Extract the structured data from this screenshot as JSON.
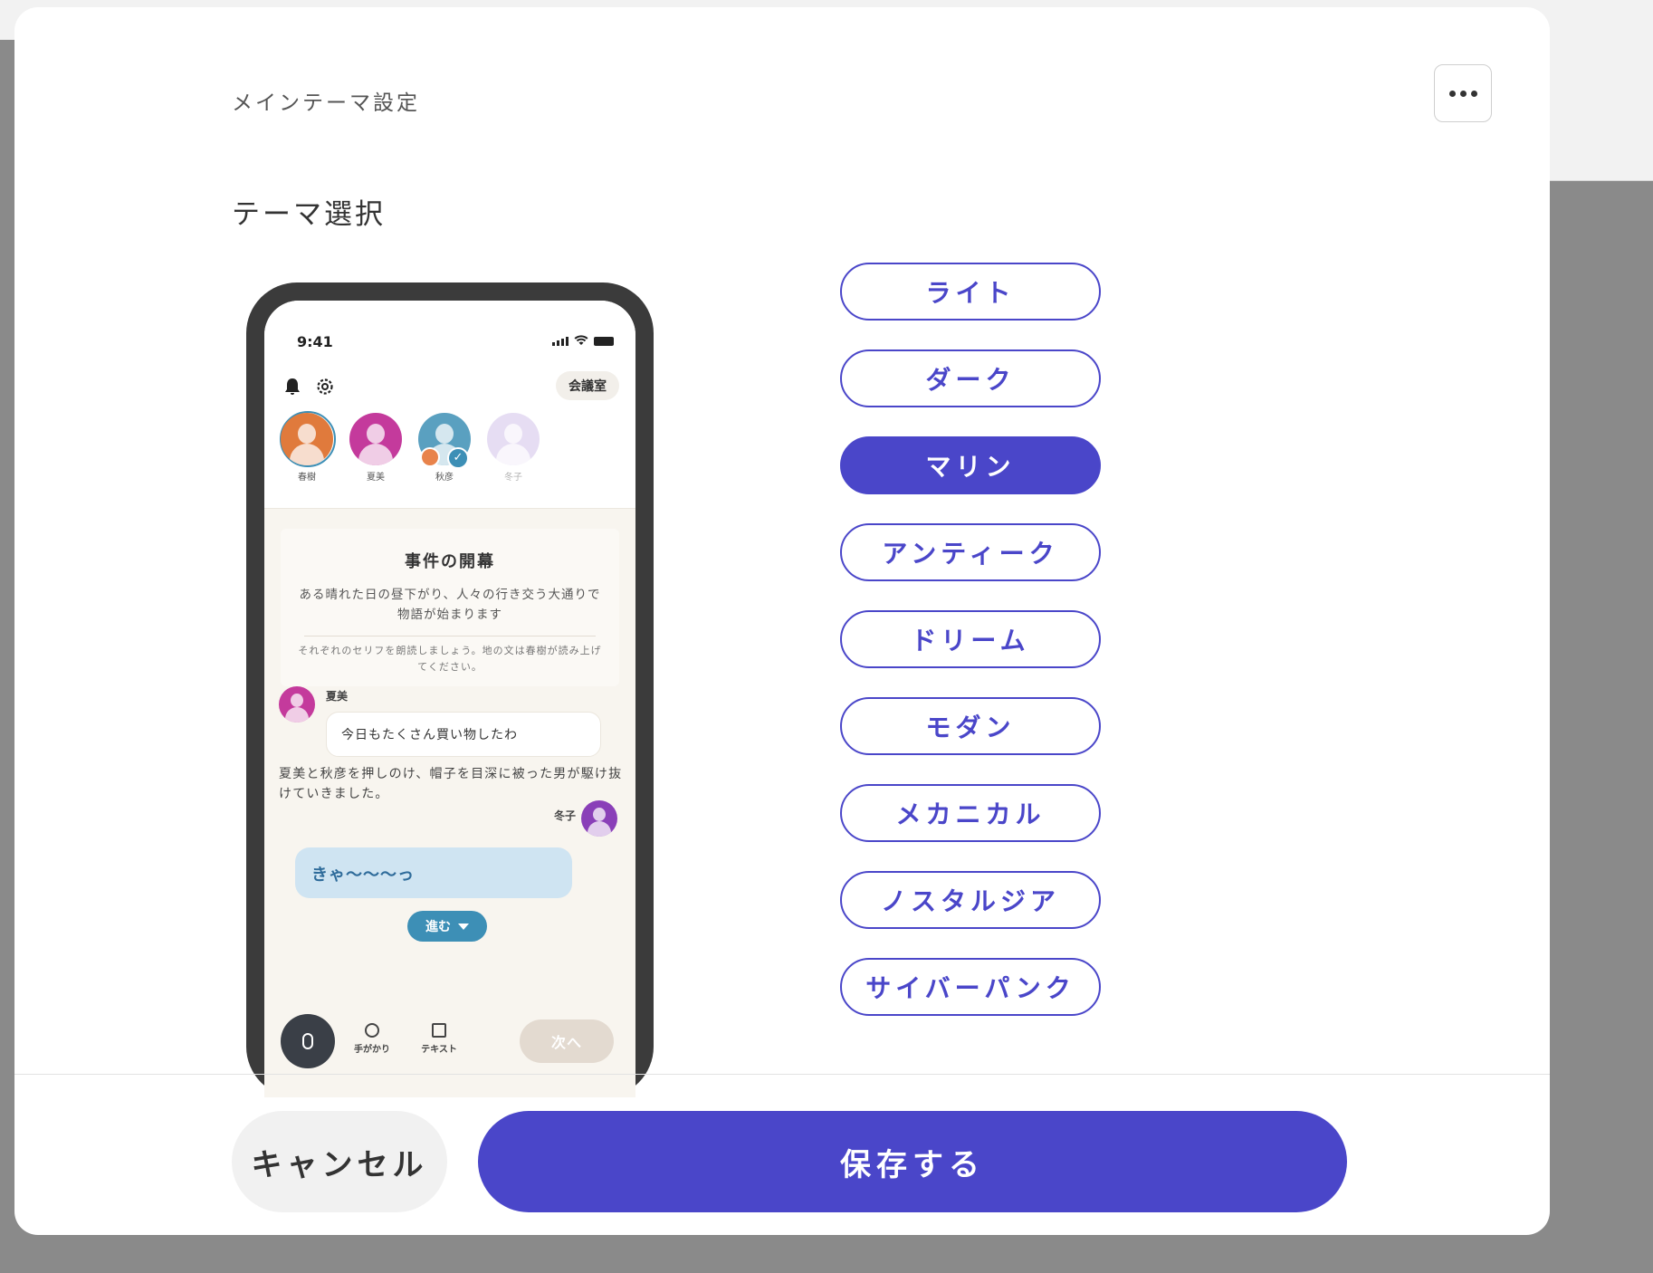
{
  "modal": {
    "title": "メインテーマ設定",
    "more_icon": "more-horizontal-icon",
    "section_title": "テーマ選択"
  },
  "preview": {
    "status_time": "9:41",
    "room_label": "会議室",
    "participants": [
      {
        "name": "春樹",
        "color": "#e07a3c"
      },
      {
        "name": "夏美",
        "color": "#c43a9c"
      },
      {
        "name": "秋彦",
        "color": "#5aa0c0"
      },
      {
        "name": "冬子",
        "color": "#c9b6e6"
      }
    ],
    "story": {
      "title": "事件の開幕",
      "body": "ある晴れた日の昼下がり、人々の行き交う大通りで物語が始まります",
      "note": "それぞれのセリフを朗読しましょう。地の文は春樹が読み上げてください。"
    },
    "messages": {
      "first_speaker": "夏美",
      "first_text": "今日もたくさん買い物したわ",
      "narration": "夏美と秋彦を押しのけ、帽子を目深に被った男が駆け抜けていきました。",
      "second_speaker": "冬子",
      "second_text": "きゃ〜〜〜っ",
      "second_color": "#8a3fb8"
    },
    "advance_label": "進む",
    "toolbar": {
      "clue_label": "手がかり",
      "text_label": "テキスト",
      "next_label": "次へ"
    }
  },
  "themes": [
    {
      "label": "ライト",
      "selected": false
    },
    {
      "label": "ダーク",
      "selected": false
    },
    {
      "label": "マリン",
      "selected": true
    },
    {
      "label": "アンティーク",
      "selected": false
    },
    {
      "label": "ドリーム",
      "selected": false
    },
    {
      "label": "モダン",
      "selected": false
    },
    {
      "label": "メカニカル",
      "selected": false
    },
    {
      "label": "ノスタルジア",
      "selected": false
    },
    {
      "label": "サイバーパンク",
      "selected": false
    }
  ],
  "footer": {
    "cancel_label": "キャンセル",
    "save_label": "保存する"
  },
  "colors": {
    "accent": "#4a46c9"
  }
}
